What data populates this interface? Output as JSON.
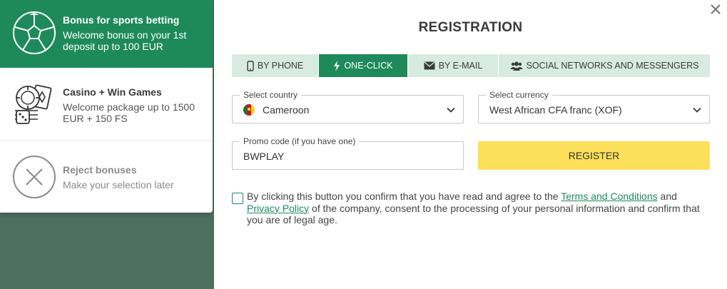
{
  "bonuses": [
    {
      "title": "Bonus for sports betting",
      "desc": "Welcome bonus on your 1st deposit up to 100 EUR",
      "icon": "soccer-ball-icon"
    },
    {
      "title": "Casino + Win Games",
      "desc": "Welcome package up to 1500 EUR + 150 FS",
      "icon": "casino-chips-icon"
    },
    {
      "title": "Reject bonuses",
      "desc": "Make your selection later",
      "icon": "reject-circle-icon"
    }
  ],
  "modal": {
    "title": "REGISTRATION",
    "tabs": [
      {
        "label": "BY PHONE",
        "icon": "phone-icon",
        "active": false
      },
      {
        "label": "ONE-CLICK",
        "icon": "lightning-icon",
        "active": true
      },
      {
        "label": "BY E-MAIL",
        "icon": "envelope-icon",
        "active": false
      },
      {
        "label": "SOCIAL NETWORKS AND MESSENGERS",
        "icon": "users-icon",
        "active": false
      }
    ],
    "country": {
      "label": "Select country",
      "value": "Cameroon"
    },
    "currency": {
      "label": "Select currency",
      "value": "West African CFA franc (XOF)"
    },
    "promo": {
      "label": "Promo code (if you have one)",
      "value": "BWPLAY"
    },
    "register_label": "REGISTER",
    "agree": {
      "text_before": "By clicking this button you confirm that you have read and agree to the ",
      "terms_link": "Terms and Conditions",
      "text_mid": " and ",
      "privacy_link": "Privacy Policy",
      "text_after": " of the company, consent to the processing of your personal information and confirm that you are of legal age."
    }
  },
  "colors": {
    "brand_green": "#1e8a5a",
    "tab_bg": "#d8ebe2",
    "register_yellow": "#fde05a"
  }
}
